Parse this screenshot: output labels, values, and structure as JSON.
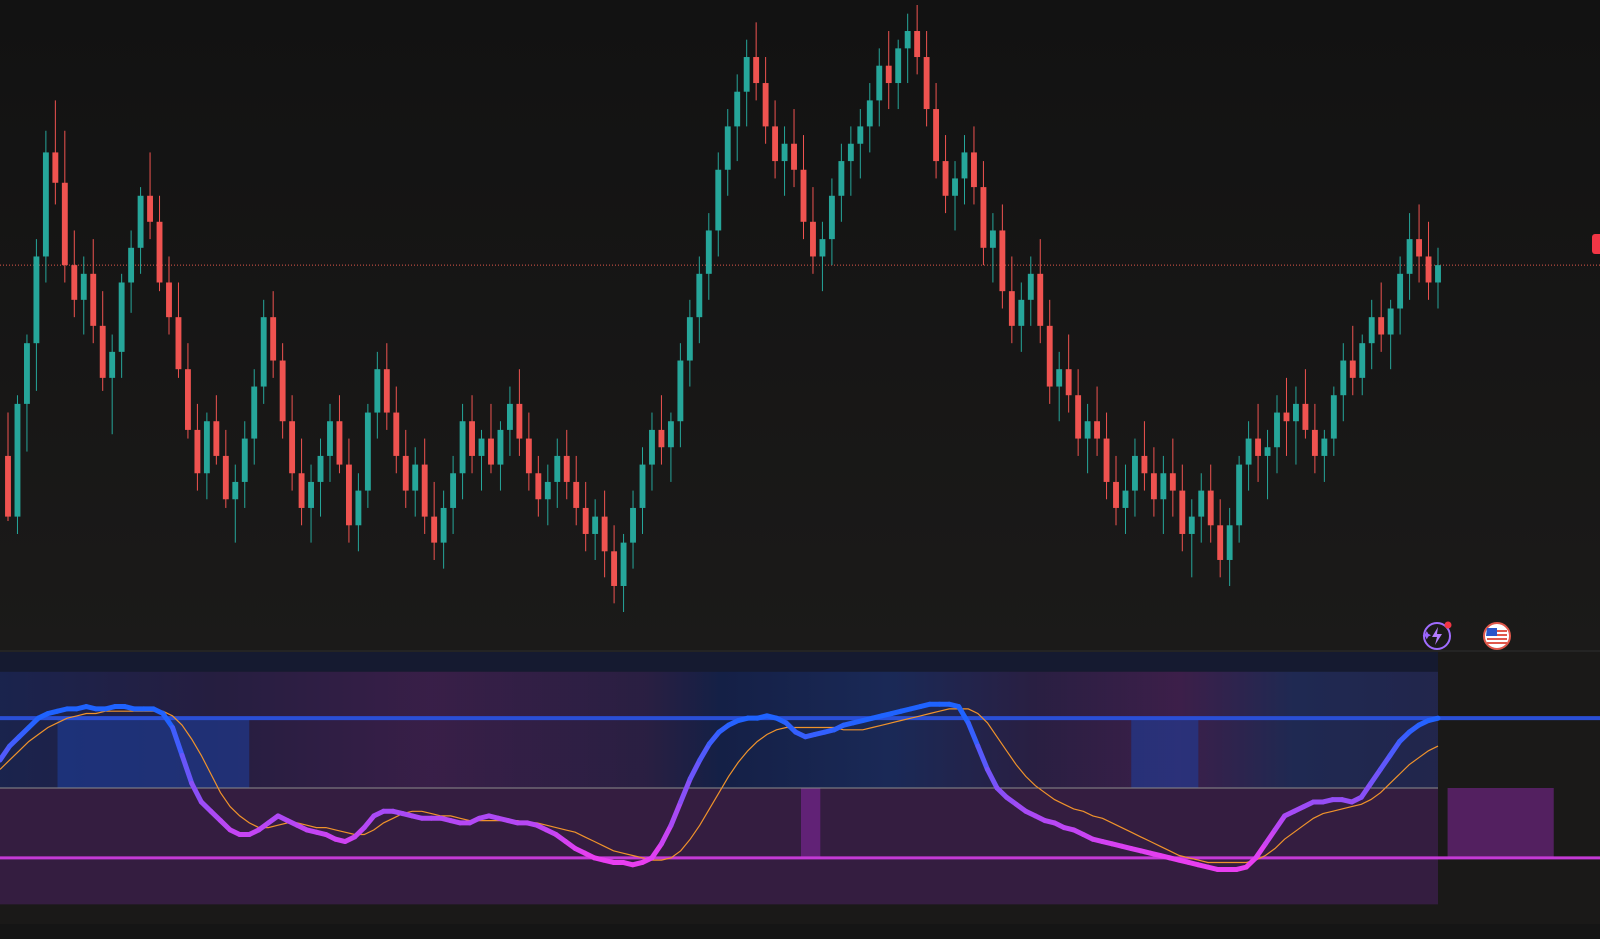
{
  "theme": {
    "background": "#131313",
    "bullish_color": "#26a69a",
    "bearish_color": "#ef5350",
    "price_line_color": "#e0584b",
    "oscillator_bull_color": "#1f63ff",
    "oscillator_bear_color": "#e83ef0",
    "signal_line_color": "#f0932b",
    "upper_band_color": "#2a4fd6",
    "lower_band_color": "#c43ad6",
    "mid_line_color": "#8c8c8c"
  },
  "toolbar": {
    "icons": [
      "ai-assistant-icon",
      "region-flag-icon"
    ]
  },
  "chart_data": [
    {
      "type": "candlestick",
      "title": "",
      "candles": [
        [
          100,
          110,
          85,
          86
        ],
        [
          86,
          114,
          82,
          112
        ],
        [
          112,
          128,
          101,
          126
        ],
        [
          126,
          150,
          115,
          146
        ],
        [
          146,
          175,
          140,
          170
        ],
        [
          170,
          182,
          158,
          163
        ],
        [
          163,
          175,
          140,
          144
        ],
        [
          144,
          152,
          132,
          136
        ],
        [
          136,
          146,
          128,
          142
        ],
        [
          142,
          150,
          126,
          130
        ],
        [
          130,
          138,
          115,
          118
        ],
        [
          118,
          128,
          105,
          124
        ],
        [
          124,
          142,
          118,
          140
        ],
        [
          140,
          152,
          133,
          148
        ],
        [
          148,
          162,
          142,
          160
        ],
        [
          160,
          170,
          150,
          154
        ],
        [
          154,
          160,
          138,
          140
        ],
        [
          140,
          146,
          128,
          132
        ],
        [
          132,
          140,
          118,
          120
        ],
        [
          120,
          126,
          104,
          106
        ],
        [
          106,
          112,
          92,
          96
        ],
        [
          96,
          110,
          90,
          108
        ],
        [
          108,
          114,
          98,
          100
        ],
        [
          100,
          106,
          88,
          90
        ],
        [
          90,
          98,
          80,
          94
        ],
        [
          94,
          108,
          88,
          104
        ],
        [
          104,
          120,
          98,
          116
        ],
        [
          116,
          136,
          112,
          132
        ],
        [
          132,
          138,
          118,
          122
        ],
        [
          122,
          126,
          104,
          108
        ],
        [
          108,
          114,
          92,
          96
        ],
        [
          96,
          104,
          84,
          88
        ],
        [
          88,
          98,
          80,
          94
        ],
        [
          94,
          104,
          86,
          100
        ],
        [
          100,
          112,
          94,
          108
        ],
        [
          108,
          114,
          96,
          98
        ],
        [
          98,
          104,
          80,
          84
        ],
        [
          84,
          96,
          78,
          92
        ],
        [
          92,
          112,
          88,
          110
        ],
        [
          110,
          124,
          104,
          120
        ],
        [
          120,
          126,
          106,
          110
        ],
        [
          110,
          116,
          96,
          100
        ],
        [
          100,
          106,
          88,
          92
        ],
        [
          92,
          102,
          86,
          98
        ],
        [
          98,
          104,
          82,
          86
        ],
        [
          86,
          94,
          76,
          80
        ],
        [
          80,
          92,
          74,
          88
        ],
        [
          88,
          100,
          82,
          96
        ],
        [
          96,
          112,
          90,
          108
        ],
        [
          108,
          114,
          96,
          100
        ],
        [
          100,
          106,
          92,
          104
        ],
        [
          104,
          112,
          96,
          98
        ],
        [
          98,
          108,
          92,
          106
        ],
        [
          106,
          116,
          100,
          112
        ],
        [
          112,
          120,
          100,
          104
        ],
        [
          104,
          110,
          92,
          96
        ],
        [
          96,
          100,
          86,
          90
        ],
        [
          90,
          98,
          84,
          94
        ],
        [
          94,
          104,
          88,
          100
        ],
        [
          100,
          106,
          90,
          94
        ],
        [
          94,
          100,
          84,
          88
        ],
        [
          88,
          94,
          78,
          82
        ],
        [
          82,
          90,
          76,
          86
        ],
        [
          86,
          92,
          72,
          78
        ],
        [
          78,
          84,
          66,
          70
        ],
        [
          70,
          82,
          64,
          80
        ],
        [
          80,
          92,
          74,
          88
        ],
        [
          88,
          102,
          82,
          98
        ],
        [
          98,
          110,
          92,
          106
        ],
        [
          106,
          114,
          98,
          102
        ],
        [
          102,
          110,
          94,
          108
        ],
        [
          108,
          126,
          102,
          122
        ],
        [
          122,
          136,
          116,
          132
        ],
        [
          132,
          146,
          126,
          142
        ],
        [
          142,
          156,
          136,
          152
        ],
        [
          152,
          170,
          146,
          166
        ],
        [
          166,
          180,
          160,
          176
        ],
        [
          176,
          188,
          168,
          184
        ],
        [
          184,
          196,
          176,
          192
        ],
        [
          192,
          200,
          182,
          186
        ],
        [
          186,
          192,
          172,
          176
        ],
        [
          176,
          182,
          164,
          168
        ],
        [
          168,
          176,
          160,
          172
        ],
        [
          172,
          180,
          162,
          166
        ],
        [
          166,
          174,
          150,
          154
        ],
        [
          154,
          162,
          142,
          146
        ],
        [
          146,
          154,
          138,
          150
        ],
        [
          150,
          164,
          144,
          160
        ],
        [
          160,
          172,
          154,
          168
        ],
        [
          168,
          176,
          160,
          172
        ],
        [
          172,
          180,
          164,
          176
        ],
        [
          176,
          186,
          170,
          182
        ],
        [
          182,
          194,
          176,
          190
        ],
        [
          190,
          198,
          180,
          186
        ],
        [
          186,
          196,
          180,
          194
        ],
        [
          194,
          202,
          186,
          198
        ],
        [
          198,
          204,
          188,
          192
        ],
        [
          192,
          198,
          176,
          180
        ],
        [
          180,
          186,
          164,
          168
        ],
        [
          168,
          174,
          156,
          160
        ],
        [
          160,
          168,
          152,
          164
        ],
        [
          164,
          174,
          158,
          170
        ],
        [
          170,
          176,
          158,
          162
        ],
        [
          162,
          168,
          144,
          148
        ],
        [
          148,
          156,
          140,
          152
        ],
        [
          152,
          158,
          134,
          138
        ],
        [
          138,
          146,
          126,
          130
        ],
        [
          130,
          140,
          124,
          136
        ],
        [
          136,
          146,
          130,
          142
        ],
        [
          142,
          150,
          126,
          130
        ],
        [
          130,
          136,
          112,
          116
        ],
        [
          116,
          124,
          108,
          120
        ],
        [
          120,
          128,
          110,
          114
        ],
        [
          114,
          120,
          100,
          104
        ],
        [
          104,
          112,
          96,
          108
        ],
        [
          108,
          116,
          100,
          104
        ],
        [
          104,
          110,
          90,
          94
        ],
        [
          94,
          100,
          84,
          88
        ],
        [
          88,
          98,
          82,
          92
        ],
        [
          92,
          104,
          86,
          100
        ],
        [
          100,
          108,
          92,
          96
        ],
        [
          96,
          102,
          86,
          90
        ],
        [
          90,
          100,
          82,
          96
        ],
        [
          96,
          104,
          86,
          92
        ],
        [
          92,
          98,
          78,
          82
        ],
        [
          82,
          90,
          72,
          86
        ],
        [
          86,
          96,
          80,
          92
        ],
        [
          92,
          98,
          80,
          84
        ],
        [
          84,
          90,
          72,
          76
        ],
        [
          76,
          88,
          70,
          84
        ],
        [
          84,
          100,
          80,
          98
        ],
        [
          98,
          108,
          92,
          104
        ],
        [
          104,
          112,
          94,
          100
        ],
        [
          100,
          106,
          90,
          102
        ],
        [
          102,
          114,
          96,
          110
        ],
        [
          110,
          118,
          100,
          108
        ],
        [
          108,
          116,
          98,
          112
        ],
        [
          112,
          120,
          104,
          106
        ],
        [
          106,
          112,
          96,
          100
        ],
        [
          100,
          106,
          94,
          104
        ],
        [
          104,
          116,
          100,
          114
        ],
        [
          114,
          126,
          108,
          122
        ],
        [
          122,
          130,
          114,
          118
        ],
        [
          118,
          128,
          114,
          126
        ],
        [
          126,
          136,
          120,
          132
        ],
        [
          132,
          140,
          124,
          128
        ],
        [
          128,
          136,
          120,
          134
        ],
        [
          134,
          146,
          128,
          142
        ],
        [
          142,
          156,
          136,
          150
        ],
        [
          150,
          158,
          140,
          146
        ],
        [
          146,
          154,
          136,
          140
        ],
        [
          140,
          148,
          134,
          144
        ]
      ],
      "current_price_line": 144,
      "grid": false
    },
    {
      "type": "line",
      "title": "",
      "ylim": [
        -5,
        105
      ],
      "levels": [
        80,
        50,
        20
      ],
      "series": [
        {
          "values": [
            62,
            68,
            72,
            76,
            80,
            82,
            83,
            84,
            84,
            85,
            84,
            84,
            85,
            85,
            84,
            84,
            84,
            82,
            76,
            64,
            52,
            44,
            40,
            36,
            32,
            30,
            30,
            32,
            35,
            38,
            36,
            34,
            32,
            31,
            30,
            28,
            27,
            29,
            33,
            38,
            40,
            40,
            39,
            38,
            37,
            37,
            37,
            36,
            35,
            35,
            37,
            38,
            37,
            36,
            35,
            35,
            34,
            32,
            30,
            27,
            24,
            22,
            20,
            19,
            18,
            18,
            17,
            18,
            20,
            26,
            34,
            44,
            54,
            62,
            69,
            74,
            77,
            79,
            80,
            80,
            81,
            80,
            78,
            74,
            72,
            73,
            74,
            75,
            77,
            78,
            79,
            80,
            81,
            82,
            83,
            84,
            85,
            86,
            86,
            86,
            85,
            78,
            68,
            58,
            50,
            46,
            43,
            40,
            38,
            36,
            35,
            33,
            32,
            30,
            28,
            27,
            26,
            25,
            24,
            23,
            22,
            21,
            20,
            19,
            18,
            17,
            16,
            15,
            15,
            15,
            16,
            20,
            26,
            32,
            38,
            40,
            42,
            44,
            44,
            45,
            45,
            44,
            46,
            52,
            58,
            64,
            70,
            74,
            77,
            79,
            80
          ]
        },
        {
          "values": [
            58,
            62,
            66,
            70,
            73,
            76,
            78,
            80,
            81,
            82,
            82,
            83,
            83,
            83,
            83,
            83,
            83,
            83,
            81,
            77,
            71,
            64,
            56,
            48,
            42,
            38,
            35,
            33,
            33,
            34,
            35,
            35,
            34,
            33,
            33,
            32,
            31,
            30,
            30,
            32,
            35,
            37,
            39,
            40,
            40,
            39,
            38,
            38,
            37,
            36,
            36,
            36,
            36,
            36,
            36,
            35,
            35,
            34,
            33,
            32,
            31,
            29,
            27,
            25,
            23,
            22,
            21,
            20,
            19,
            19,
            20,
            23,
            28,
            34,
            41,
            48,
            55,
            61,
            66,
            70,
            73,
            75,
            76,
            76,
            76,
            76,
            76,
            76,
            75,
            75,
            75,
            76,
            77,
            78,
            79,
            80,
            81,
            82,
            83,
            84,
            84,
            84,
            82,
            78,
            72,
            66,
            60,
            55,
            51,
            48,
            45,
            43,
            41,
            40,
            38,
            37,
            35,
            33,
            31,
            29,
            27,
            25,
            23,
            21,
            20,
            19,
            18,
            18,
            18,
            18,
            18,
            19,
            21,
            24,
            28,
            31,
            34,
            37,
            39,
            40,
            41,
            42,
            43,
            45,
            48,
            52,
            56,
            60,
            63,
            66,
            68
          ]
        }
      ],
      "grid": false
    }
  ]
}
